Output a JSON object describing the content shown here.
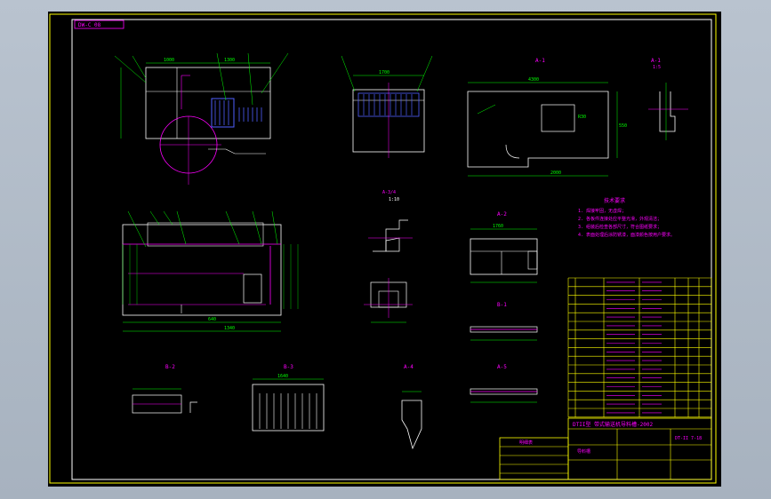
{
  "drawing": {
    "stamp_label": "DW-C 08",
    "views": {
      "a1": "A-1",
      "a1_scale": "1:5",
      "a1_detail": "A-1",
      "a1_detail_scale": "1:5",
      "mid": "A-3/4",
      "mid_scale": "1:10",
      "a2": "A-2",
      "a5": "A-5",
      "b1": "B-1",
      "b1_scale": "1:10",
      "b2": "B-2",
      "b3": "B-3",
      "b4": "A-4",
      "b4_scale": "1:10"
    },
    "dims": {
      "d1": "1000",
      "d2": "1300",
      "d3": "1700",
      "d4": "4300",
      "d5": "2000",
      "d6": "550",
      "d7": "R30",
      "d8": "1340",
      "d9": "640",
      "d10": "1760",
      "d11": "P31",
      "d12": "1640",
      "d13": "630",
      "d14": "7"
    },
    "notes": {
      "heading": "技术要求",
      "lines": [
        "1. 焊接牢固，无虚焊；",
        "2. 各板件连接处应平整光滑，外观清洁；",
        "3. 组装后检查各部尺寸，符合图纸要求；",
        "4. 表面处理后涂防锈漆，面漆颜色按用户要求。"
      ]
    },
    "title_block": {
      "title": "DTII型 带式输送机导料槽-2002",
      "drawing_no": "DT-II 7-18",
      "sheet": "1:10",
      "name": "导料槽",
      "left_heading": "明细表"
    },
    "colors": {
      "background": "#000000",
      "lines": "#ffffff",
      "dimensions": "#00ff00",
      "centerlines": "#ff00ff",
      "labels": "#ff00ff",
      "border": "#ffff00",
      "hatch": "#5060ff"
    }
  }
}
